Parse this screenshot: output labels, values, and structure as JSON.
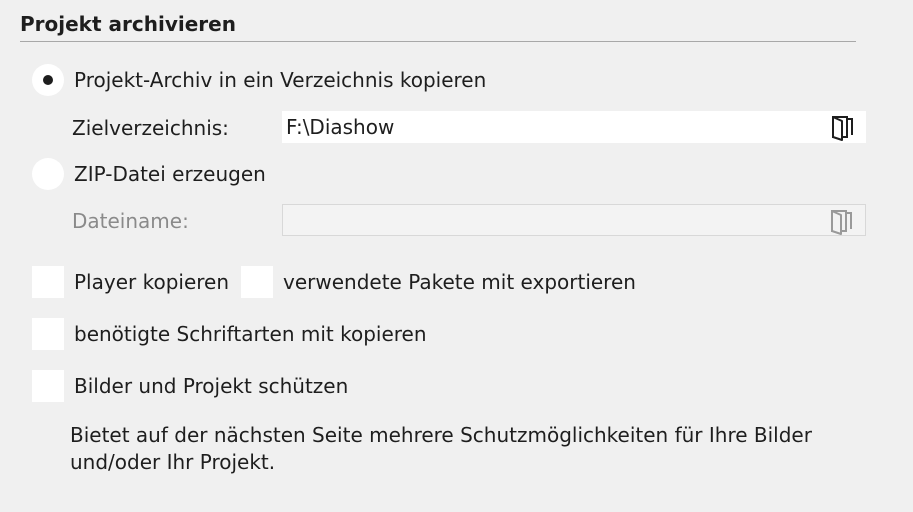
{
  "section": {
    "title": "Projekt archivieren"
  },
  "option_copy_dir": {
    "label": "Projekt-Archiv in ein Verzeichnis kopieren",
    "selected": true
  },
  "target_dir": {
    "label": "Zielverzeichnis:",
    "value": "F:\\Diashow",
    "icon": "folder-icon"
  },
  "option_zip": {
    "label": "ZIP-Datei erzeugen",
    "selected": false
  },
  "file_name": {
    "label": "Dateiname:",
    "value": "",
    "disabled": true,
    "icon": "folder-icon"
  },
  "checkboxes": {
    "copy_player": {
      "label": "Player kopieren",
      "checked": false
    },
    "export_packages": {
      "label": "verwendete Pakete mit exportieren",
      "checked": false
    },
    "copy_fonts": {
      "label": "benötigte Schriftarten mit kopieren",
      "checked": false
    },
    "protect": {
      "label": "Bilder und Projekt schützen",
      "checked": false
    }
  },
  "description": "Bietet auf der nächsten Seite mehrere Schutzmöglichkeiten für Ihre Bilder und/oder Ihr Projekt."
}
